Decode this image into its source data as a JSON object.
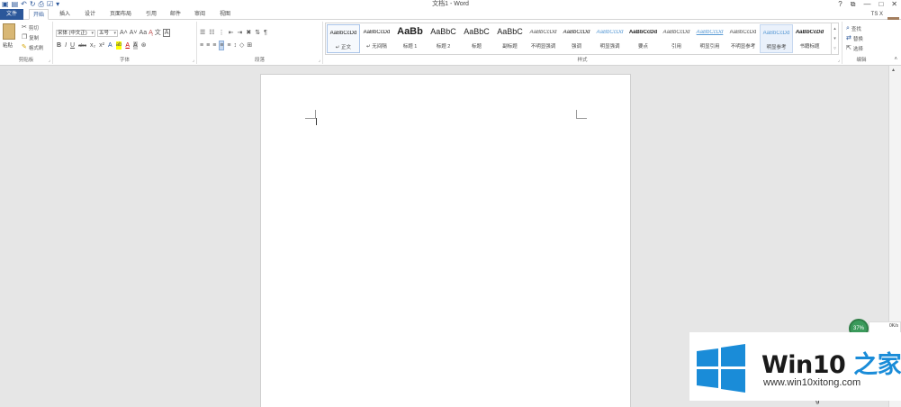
{
  "qat": {
    "icons": [
      "save-icon",
      "undo-icon",
      "redo-icon",
      "print-preview-icon",
      "spelling-icon",
      "customize-icon"
    ]
  },
  "title": "文档1 - Word",
  "window": {
    "help": "?",
    "restore_ribbon": "⧉",
    "minimize": "—",
    "maximize": "□",
    "close": "✕"
  },
  "tabs": [
    "文件",
    "开始",
    "插入",
    "设计",
    "页面布局",
    "引用",
    "邮件",
    "审阅",
    "视图"
  ],
  "user": "TS X",
  "ribbon": {
    "clipboard": {
      "paste": "粘贴",
      "cut": "剪切",
      "copy": "复制",
      "format_painter": "格式刷",
      "label": "剪贴板"
    },
    "font": {
      "font_name": "宋体 (中文正)",
      "font_size": "五号",
      "label": "字体",
      "row1_glyphs": [
        "A˄",
        "A˅",
        "Aa",
        "Ą",
        "文",
        "A"
      ],
      "row2_glyphs": [
        "B",
        "I",
        "U",
        "abc",
        "x₂",
        "x²",
        "A",
        "ab",
        "A",
        "A",
        "⊛"
      ]
    },
    "paragraph": {
      "label": "段落"
    },
    "styles": {
      "label": "样式",
      "items": [
        {
          "preview": "AaBbCcDd",
          "name": "↵ 正文"
        },
        {
          "preview": "AaBbCcDd",
          "name": "↵ 无间隔"
        },
        {
          "preview": "AaBb",
          "name": "标题 1"
        },
        {
          "preview": "AaBbC",
          "name": "标题 2"
        },
        {
          "preview": "AaBbC",
          "name": "标题"
        },
        {
          "preview": "AaBbC",
          "name": "副标题"
        },
        {
          "preview": "AaBbCcDd",
          "name": "不明显强调"
        },
        {
          "preview": "AaBbCcDd",
          "name": "强调"
        },
        {
          "preview": "AaBbCcDd",
          "name": "明显强调"
        },
        {
          "preview": "AaBbCcDd",
          "name": "要点"
        },
        {
          "preview": "AaBbCcDd",
          "name": "引用"
        },
        {
          "preview": "AaBbCcDd",
          "name": "明显引用"
        },
        {
          "preview": "AaBbCcDd",
          "name": "不明显参考"
        },
        {
          "preview": "AaBbCcDd",
          "name": "明显参考"
        },
        {
          "preview": "AaBbCcDd",
          "name": "书籍标题"
        }
      ]
    },
    "editing": {
      "find": "查找",
      "replace": "替换",
      "select": "选择",
      "label": "编辑"
    }
  },
  "net_widget": {
    "percent": "37%",
    "speed": "0K/s"
  },
  "watermark": {
    "title_prefix": "Win10 ",
    "title_suffix": "之家",
    "url": "www.win10xitong.com"
  },
  "behind_text": "g"
}
